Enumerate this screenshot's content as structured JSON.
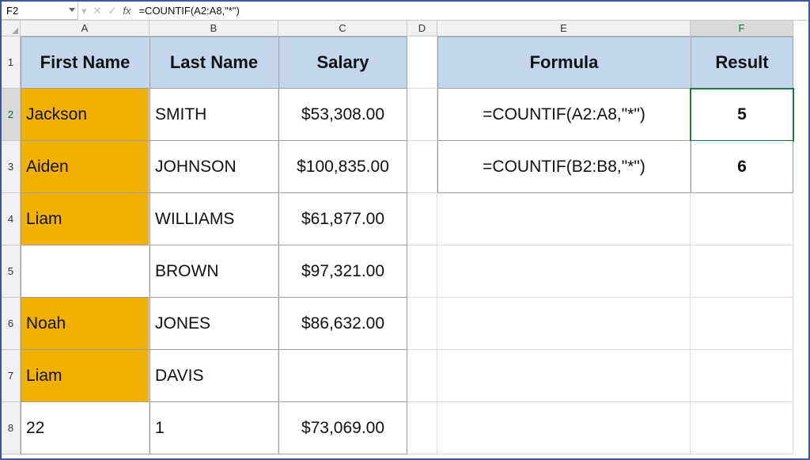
{
  "namebox": "F2",
  "formula_bar": "=COUNTIF(A2:A8,\"*\")",
  "col_headers": [
    "A",
    "B",
    "C",
    "D",
    "E",
    "F"
  ],
  "row_headers": [
    "1",
    "2",
    "3",
    "4",
    "5",
    "6",
    "7",
    "8"
  ],
  "table1": {
    "headers": [
      "First Name",
      "Last Name",
      "Salary"
    ],
    "rows": [
      {
        "first": "Jackson",
        "last": "SMITH",
        "salary": "$53,308.00",
        "orange": true
      },
      {
        "first": "Aiden",
        "last": "JOHNSON",
        "salary": "$100,835.00",
        "orange": true
      },
      {
        "first": "Liam",
        "last": "WILLIAMS",
        "salary": "$61,877.00",
        "orange": true
      },
      {
        "first": "",
        "last": "BROWN",
        "salary": "$97,321.00",
        "orange": false
      },
      {
        "first": "Noah",
        "last": "JONES",
        "salary": "$86,632.00",
        "orange": true
      },
      {
        "first": "Liam",
        "last": "DAVIS",
        "salary": "",
        "orange": true
      },
      {
        "first": "22",
        "last": "1",
        "salary": "$73,069.00",
        "orange": false
      }
    ]
  },
  "table2": {
    "headers": [
      "Formula",
      "Result"
    ],
    "rows": [
      {
        "formula": "=COUNTIF(A2:A8,\"*\")",
        "result": "5"
      },
      {
        "formula": "=COUNTIF(B2:B8,\"*\")",
        "result": "6"
      }
    ]
  },
  "chart_data": null
}
